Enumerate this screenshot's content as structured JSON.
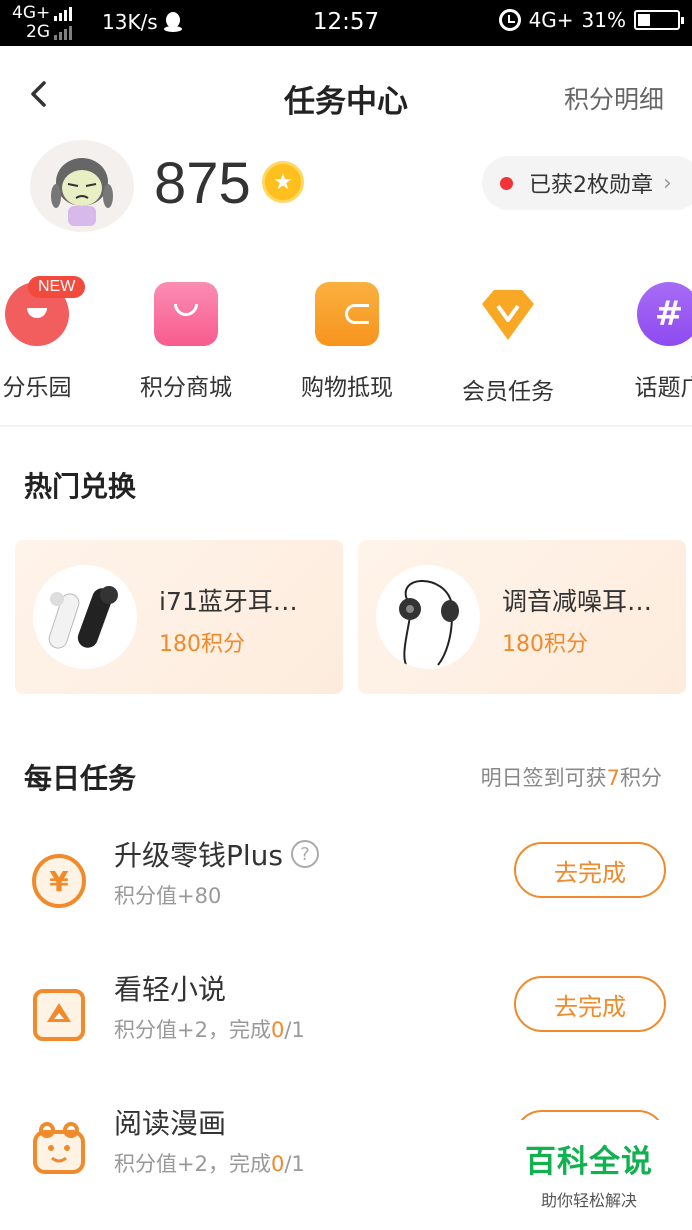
{
  "status_bar": {
    "net_top": "4G+",
    "net_bottom": "2G",
    "speed": "13K/s",
    "time": "12:57",
    "net_right": "4G+",
    "battery": "31%"
  },
  "header": {
    "title": "任务中心",
    "detail_link": "积分明细"
  },
  "profile": {
    "points": "875",
    "medal_text": "已获2枚勋章"
  },
  "shortcuts": {
    "new_badge": "NEW",
    "items": [
      {
        "label": "分乐园",
        "icon": "paradise-icon",
        "color": "#f25e5e"
      },
      {
        "label": "积分商城",
        "icon": "shopping-bag-icon",
        "color": "#f85b8e"
      },
      {
        "label": "购物抵现",
        "icon": "wallet-icon",
        "color": "#f7941d"
      },
      {
        "label": "会员任务",
        "icon": "diamond-icon",
        "color": "#f9a825"
      },
      {
        "label": "话题广",
        "icon": "hashtag-icon",
        "color": "#8e4af0"
      }
    ]
  },
  "hot_exchange": {
    "title": "热门兑换",
    "items": [
      {
        "name": "i71蓝牙耳…",
        "points": "180积分",
        "icon": "bluetooth-earphone-icon"
      },
      {
        "name": "调音减噪耳…",
        "points": "180积分",
        "icon": "in-ear-earphone-icon"
      }
    ]
  },
  "daily_tasks": {
    "title": "每日任务",
    "tomorrow_prefix": "明日签到可获",
    "tomorrow_value": "7",
    "tomorrow_suffix": "积分",
    "button_label": "去完成",
    "items": [
      {
        "name": "升级零钱Plus",
        "sub_prefix": "积分值+80",
        "progress_done": "",
        "progress_total": "",
        "icon": "yuan-coin-icon",
        "has_help": true
      },
      {
        "name": "看轻小说",
        "sub_prefix": "积分值+2，完成",
        "progress_done": "0",
        "progress_total": "/1",
        "icon": "novel-icon",
        "has_help": false
      },
      {
        "name": "阅读漫画",
        "sub_prefix": "积分值+2，完成",
        "progress_done": "0",
        "progress_total": "/1",
        "icon": "comic-icon",
        "has_help": false
      }
    ]
  },
  "watermark": {
    "line1": "百科全说",
    "line2": "助你轻松解决"
  },
  "colors": {
    "accent": "#f08a2a",
    "red_dot": "#f2333a",
    "coin": "#ffbf1f",
    "watermark_green": "#11b14f"
  }
}
